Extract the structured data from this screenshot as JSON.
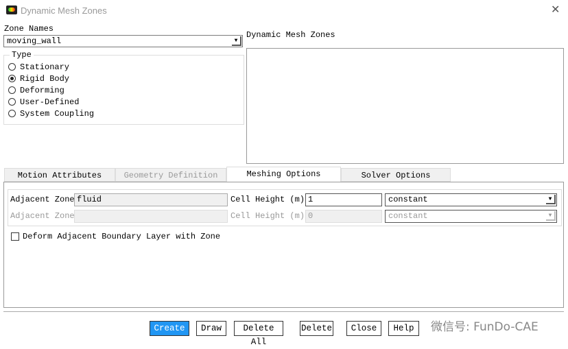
{
  "window": {
    "title": "Dynamic Mesh Zones",
    "close": "✕"
  },
  "zone_names": {
    "label": "Zone Names",
    "value": "moving_wall"
  },
  "type": {
    "label": "Type",
    "options": [
      "Stationary",
      "Rigid Body",
      "Deforming",
      "User-Defined",
      "System Coupling"
    ],
    "selected": "Rigid Body"
  },
  "dynamic_zones": {
    "label": "Dynamic Mesh Zones",
    "items": []
  },
  "tabs": [
    {
      "label": "Motion Attributes",
      "state": "normal"
    },
    {
      "label": "Geometry Definition",
      "state": "disabled"
    },
    {
      "label": "Meshing Options",
      "state": "active"
    },
    {
      "label": "Solver Options",
      "state": "normal"
    }
  ],
  "meshing": {
    "row1": {
      "zone_label": "Adjacent Zone",
      "zone_value": "fluid",
      "height_label": "Cell Height (m)",
      "height_value": "1",
      "profile": "constant"
    },
    "row2": {
      "zone_label": "Adjacent Zone",
      "zone_value": "",
      "height_label": "Cell Height (m)",
      "height_value": "0",
      "profile": "constant"
    },
    "deform_checkbox": {
      "label": "Deform Adjacent Boundary Layer with Zone",
      "checked": false
    }
  },
  "buttons": [
    "Create",
    "Draw",
    "Delete All",
    "Delete",
    "Close",
    "Help"
  ],
  "accent": "#2196f3",
  "watermark": "微信号: FunDo-CAE"
}
